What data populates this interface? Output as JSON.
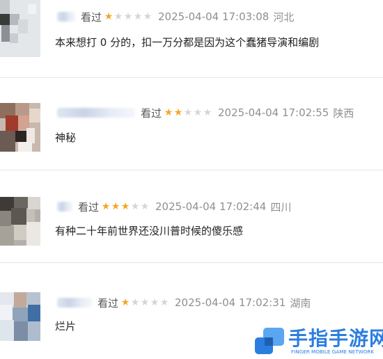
{
  "comments": [
    {
      "watched_label": "看过",
      "rating": 1,
      "time": "2025-04-04 17:03:08",
      "location": "河北",
      "text": "本来想打 0 分的，扣一万分都是因为这个蠢猪导演和编剧"
    },
    {
      "watched_label": "看过",
      "rating": 2,
      "time": "2025-04-04 17:02:55",
      "location": "陕西",
      "text": "神秘"
    },
    {
      "watched_label": "看过",
      "rating": 3,
      "time": "2025-04-04 17:02:44",
      "location": "四川",
      "text": "有种二十年前世界还没川普时候的傻乐感"
    },
    {
      "watched_label": "看过",
      "rating": 1,
      "time": "2025-04-04 17:02:31",
      "location": "湖南",
      "text": "烂片"
    }
  ],
  "star_icon": "star-icon",
  "colors": {
    "star_on": "#f5a623",
    "star_off": "#d5d5d5",
    "meta_text": "#8f8f8f",
    "watermark": "#2b7ee0"
  },
  "watermark": {
    "title": "手指手游网",
    "subtitle": "FINGER MOBILE GAME NETWORK"
  }
}
